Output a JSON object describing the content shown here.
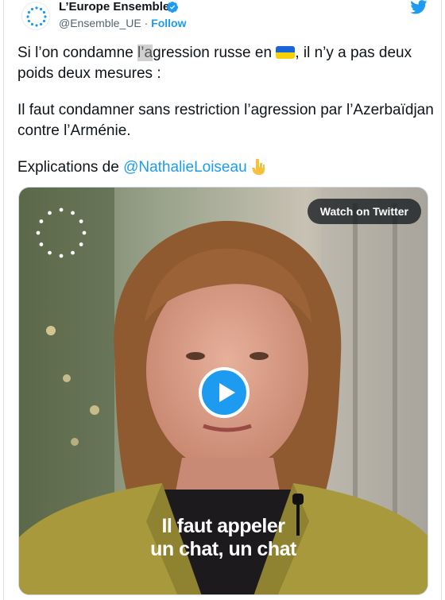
{
  "author": {
    "display_name": "L’Europe Ensemble",
    "handle": "@Ensemble_UE",
    "separator": "·",
    "follow_label": "Follow",
    "verified": true
  },
  "tweet": {
    "line1_before": "Si l’on condamne ",
    "line1_highlight": "l’a",
    "line1_after_hl": "gression russe en ",
    "line1_after_flag": ", il n’y a pas deux poids deux mesures :",
    "para2": "Il faut condamner sans restriction l’agression par l’Azerbaïdjan contre l’Arménie.",
    "para3_before": "Explications de ",
    "mention": "@NathalieLoiseau",
    "flag_icon": "ukraine-flag-icon",
    "emoji_icon": "pointing-down-icon"
  },
  "media": {
    "watch_label": "Watch on Twitter",
    "caption_line1": "Il faut appeler",
    "caption_line2": "un chat, un chat",
    "play_icon": "play-icon"
  },
  "colors": {
    "accent": "#1d9bf0",
    "text": "#0f1419",
    "muted": "#536471",
    "flag_blue": "#1a66d6",
    "flag_yellow": "#f7d108"
  }
}
